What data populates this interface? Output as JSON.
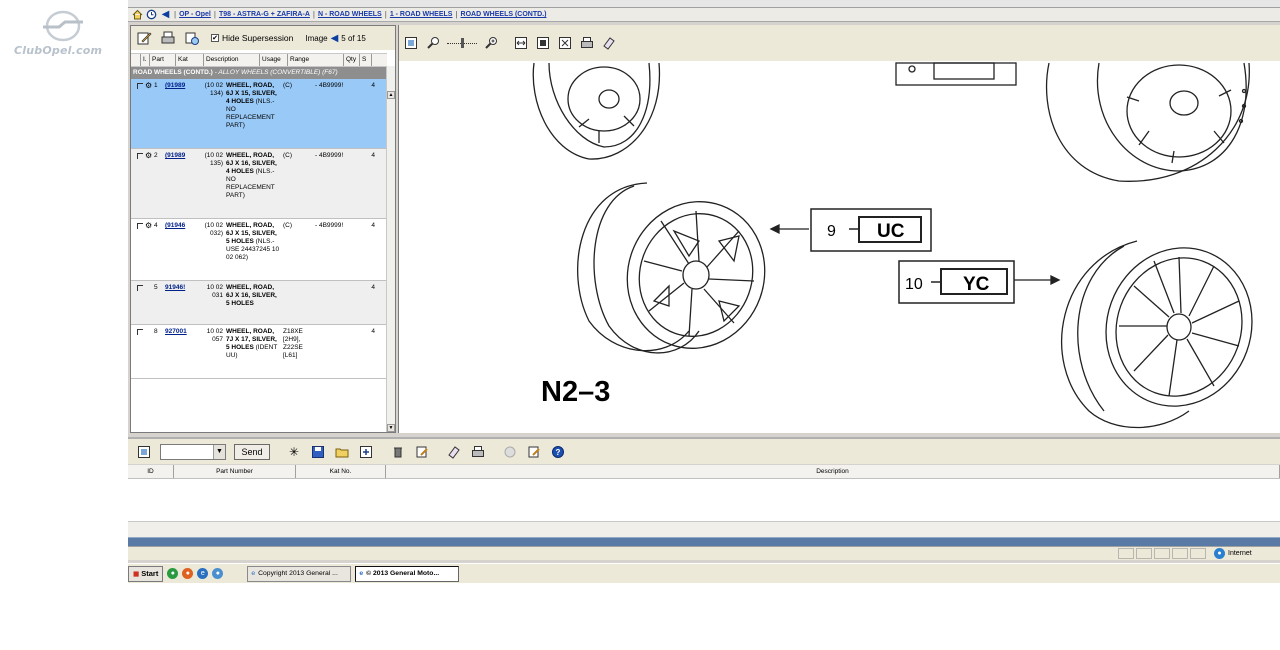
{
  "logo": {
    "text": "ClubOpel.com"
  },
  "breadcrumb": {
    "items": [
      "OP - Opel",
      "T98 - ASTRA-G + ZAFIRA-A",
      "N - ROAD WHEELS",
      "1 - ROAD WHEELS",
      "ROAD WHEELS (CONTD.)"
    ]
  },
  "parts_toolbar": {
    "hide_supersession_label": "Hide Supersession",
    "hide_supersession_checked": "✔",
    "image_label": "Image",
    "image_counter": "5 of 15"
  },
  "parts_table": {
    "headers": [
      "I.",
      "Part",
      "Kat",
      "Description",
      "Usage",
      "Range",
      "Qty",
      "S"
    ],
    "group_title": "ROAD WHEELS (CONTD.)",
    "group_subtitle": "- ALLOY WHEELS (CONVERTIBLE) (F67)",
    "rows": [
      {
        "num": "1",
        "part": "(91989",
        "kat": "(10 02 134)",
        "desc_bold": "WHEEL, ROAD, 6J X 15, SILVER, 4 HOLES",
        "desc_note": "(NLS.- NO REPLACEMENT PART)",
        "usage": "(C)",
        "range": "- 4B9999!",
        "qty": "4"
      },
      {
        "num": "2",
        "part": "(91989",
        "kat": "(10 02 135)",
        "desc_bold": "WHEEL, ROAD, 6J X 16, SILVER, 4 HOLES",
        "desc_note": "(NLS.- NO REPLACEMENT PART)",
        "usage": "(C)",
        "range": "- 4B9999!",
        "qty": "4"
      },
      {
        "num": "4",
        "part": "(91946",
        "kat": "(10 02 032)",
        "desc_bold": "WHEEL, ROAD, 6J X 15, SILVER, 5 HOLES",
        "desc_note": "(NLS.- USE 24437245 10 02 062)",
        "usage": "(C)",
        "range": "- 4B9999!",
        "qty": "4"
      },
      {
        "num": "5",
        "part": "91946!",
        "kat": "10 02 031",
        "desc_bold": "WHEEL, ROAD, 6J X 16, SILVER, 5 HOLES",
        "desc_note": "",
        "usage": "",
        "range": "",
        "qty": "4"
      },
      {
        "num": "8",
        "part": "927001",
        "kat": "10 02 057",
        "desc_bold": "WHEEL, ROAD, 7J X 17, SILVER, 5 HOLES",
        "desc_note": "(IDENT UU)",
        "usage": "Z18XE [2H9], Z22SE [L61]",
        "range": "",
        "qty": "4"
      }
    ]
  },
  "diagram": {
    "label": "N2–3",
    "callouts": [
      {
        "num": "9",
        "code": "UC"
      },
      {
        "num": "10",
        "code": "YC"
      }
    ]
  },
  "bottom_toolbar": {
    "send_label": "Send"
  },
  "part_list": {
    "headers": [
      "ID",
      "Part Number",
      "Kat No.",
      "Description"
    ]
  },
  "statusbar": {
    "zone": "Internet"
  },
  "taskbar": {
    "start_label": "Start",
    "tasks": [
      "Copyright 2013 General ...",
      "© 2013 General Moto..."
    ]
  },
  "colors": {
    "selected_row": "#99c9f7",
    "link": "#1a3aa8",
    "splitter": "#5a7aa6"
  }
}
